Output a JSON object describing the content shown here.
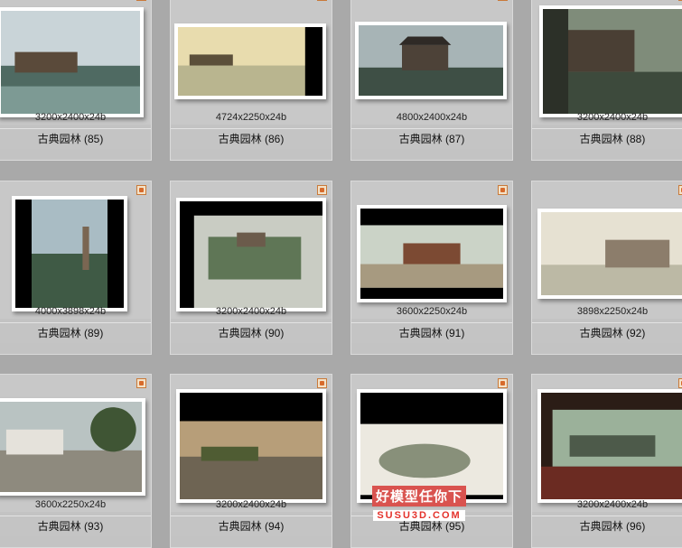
{
  "items": [
    {
      "dims": "3200x2400x24b",
      "caption": "古典园林 (85)"
    },
    {
      "dims": "4724x2250x24b",
      "caption": "古典园林 (86)"
    },
    {
      "dims": "4800x2400x24b",
      "caption": "古典园林 (87)"
    },
    {
      "dims": "3200x2400x24b",
      "caption": "古典园林 (88)"
    },
    {
      "dims": "4000x3898x24b",
      "caption": "古典园林 (89)"
    },
    {
      "dims": "3200x2400x24b",
      "caption": "古典园林 (90)"
    },
    {
      "dims": "3600x2250x24b",
      "caption": "古典园林 (91)"
    },
    {
      "dims": "3898x2250x24b",
      "caption": "古典园林 (92)"
    },
    {
      "dims": "3600x2250x24b",
      "caption": "古典园林 (93)"
    },
    {
      "dims": "3200x2400x24b",
      "caption": "古典园林 (94)"
    },
    {
      "dims": "",
      "caption": "古典园林 (95)"
    },
    {
      "dims": "3200x2400x24b",
      "caption": "古典园林 (96)"
    }
  ],
  "watermark": {
    "cn": "好模型任你下",
    "en": "SUSU3D.COM"
  },
  "icons": {
    "badge": "image-file-icon"
  }
}
